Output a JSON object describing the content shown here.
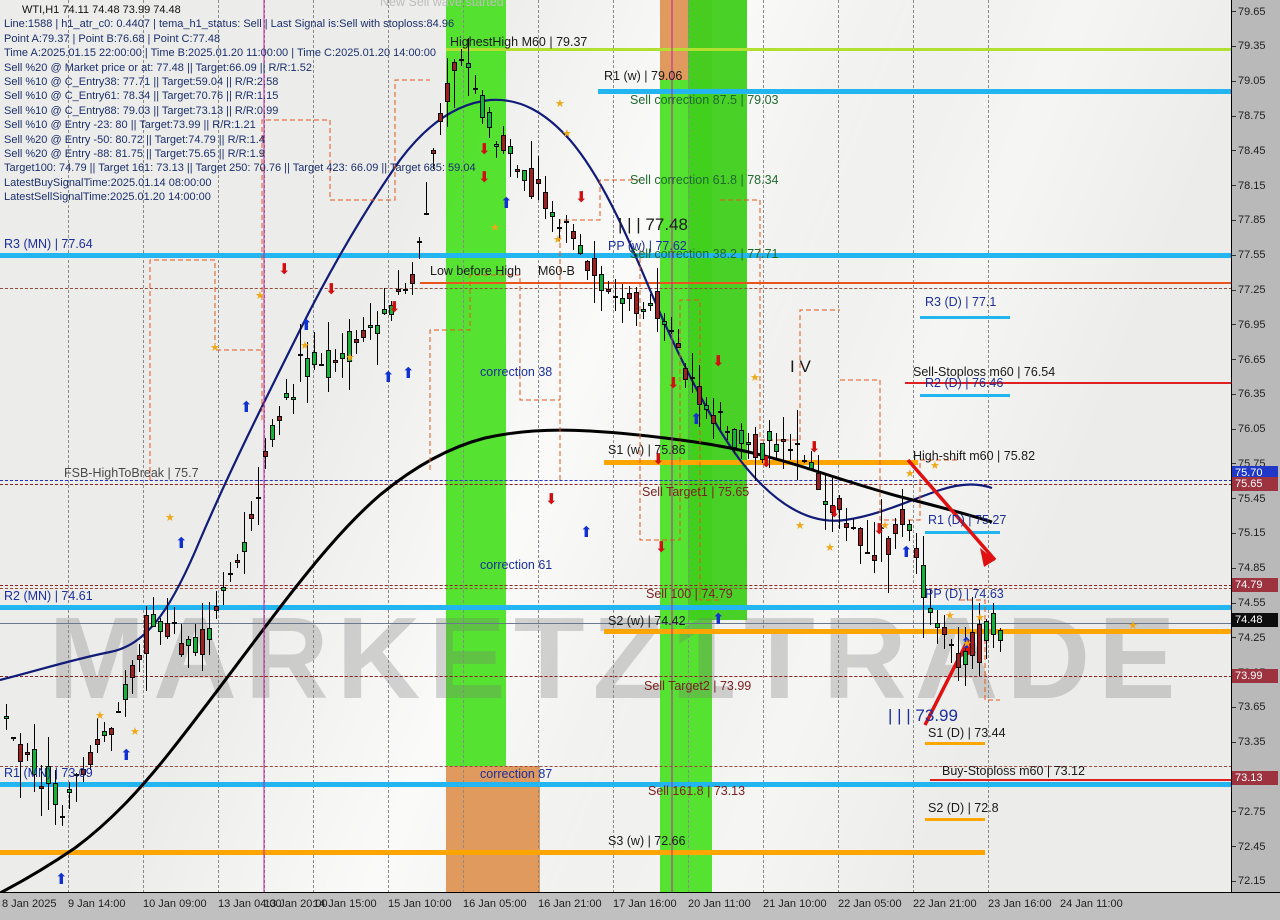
{
  "window": {
    "title": "WTI,H1"
  },
  "header": {
    "symbol_line": "WTI,H1  74.11 74.48 73.99 74.48",
    "lines": [
      "Line:1588 | h1_atr_c0: 0.4407 | tema_h1_status: Sell | Last Signal is:Sell with stoploss:84.96",
      "Point A:79.37 |  Point B:76.68 |  Point C:77.48",
      "Time A:2025.01.15 22:00:00 | Time B:2025.01.20 11:00:00 | Time C:2025.01.20 14:00:00",
      "Sell %20 @ Market price or at: 77.48 || Target:66.09 || R/R:1.52",
      "Sell %10 @ C_Entry38: 77.71 || Target:59.04 || R/R:2.58",
      "Sell %10 @ C_Entry61: 78.34 || Target:70.76 || R/R:1.15",
      "Sell %10 @ C_Entry88: 79.03 || Target:73.13 || R/R:0.99",
      "Sell %10 @ Entry -23: 80 || Target:73.99 || R/R:1.21",
      "Sell %20 @ Entry -50: 80.72 || Target:74.79 || R/R:1.4",
      "Sell %20 @ Entry -88: 81.75 || Target:75.65 || R/R:1.9",
      "Target100: 74.79 || Target 161: 73.13 || Target 250: 70.76 || Target 423: 66.09 || Target 685: 59.04",
      "LatestBuySignalTime:2025.01.14 08:00:00",
      "LatestSellSignalTime:2025.01.20 14:00:00"
    ],
    "wave_banner": "New Sell wave started"
  },
  "watermark": "MARKETZ1TRADE",
  "chart_data": {
    "type": "line",
    "title": "WTI,H1  74.11 74.48 73.99 74.48",
    "xlabel": "",
    "ylabel": "",
    "ylim": [
      72.05,
      79.75
    ],
    "grid": true,
    "legend": "none",
    "price_ticks": [
      79.65,
      79.35,
      79.05,
      78.75,
      78.45,
      78.15,
      77.85,
      77.55,
      77.25,
      76.95,
      76.65,
      76.35,
      76.05,
      75.75,
      75.45,
      75.15,
      74.85,
      74.55,
      74.25,
      73.95,
      73.65,
      73.35,
      73.05,
      72.75,
      72.45,
      72.15
    ],
    "time_ticks": [
      "8 Jan 2025",
      "9 Jan 14:00",
      "10 Jan 09:00",
      "13 Jan 04:00",
      "13 Jan 20:00",
      "14 Jan 15:00",
      "15 Jan 10:00",
      "16 Jan 05:00",
      "16 Jan 21:00",
      "17 Jan 16:00",
      "20 Jan 11:00",
      "21 Jan 10:00",
      "22 Jan 05:00",
      "22 Jan 21:00",
      "23 Jan 16:00",
      "24 Jan 11:00"
    ],
    "price_badges": [
      {
        "value": "75.70",
        "style": "blue"
      },
      {
        "value": "75.65",
        "style": "red"
      },
      {
        "value": "74.79",
        "style": "red"
      },
      {
        "value": "74.48",
        "style": "black"
      },
      {
        "value": "73.99",
        "style": "red"
      },
      {
        "value": "73.13",
        "style": "red"
      }
    ],
    "levels": [
      {
        "label": "HighestHigh  M60 | 79.37",
        "value": 79.37,
        "color": "#b3e030",
        "kind": "lime"
      },
      {
        "label": "R1 (w) | 79.06",
        "value": 79.06,
        "color": "#22b5f0",
        "kind": "cyan"
      },
      {
        "label": "Sell correction 87.5 | 79.03",
        "value": 79.03,
        "color": "#1f6b2e",
        "kind": "text"
      },
      {
        "label": "Sell correction 61.8 | 78.34",
        "value": 78.34,
        "color": "#1f6b2e",
        "kind": "text"
      },
      {
        "label": "| | | 77.48",
        "value": 77.48,
        "color": "#1a1a1a",
        "kind": "text"
      },
      {
        "label": "PP (w) | 77.62",
        "value": 77.62,
        "color": "#1b2f9e",
        "kind": "cyan"
      },
      {
        "label": "Sell correction 38.2 | 77.71",
        "value": 77.71,
        "color": "#1f6b2e",
        "kind": "text"
      },
      {
        "label": "R3 (MN) | 77.64",
        "value": 77.64,
        "color": "#22b5f0",
        "kind": "cyan"
      },
      {
        "label": "Low before High",
        "value": 77.2,
        "color": "#1a1a1a",
        "kind": "text"
      },
      {
        "label": "M60-B",
        "value": 77.2,
        "color": "#1a1a1a",
        "kind": "text"
      },
      {
        "label": "R3 (D) | 77.1",
        "value": 77.1,
        "color": "#22b5f0",
        "kind": "cyan-t"
      },
      {
        "label": "Sell-Stoploss m60 | 76.54",
        "value": 76.54,
        "color": "#e02020",
        "kind": "red"
      },
      {
        "label": "R2 (D) | 76.46",
        "value": 76.46,
        "color": "#22b5f0",
        "kind": "cyan-t"
      },
      {
        "label": "S1 (w) | 75.86",
        "value": 75.86,
        "color": "#ffa500",
        "kind": "orange"
      },
      {
        "label": "High-shift m60 | 75.82",
        "value": 75.82,
        "color": "#1f6b2e",
        "kind": "text"
      },
      {
        "label": "FSB-HighToBreak | 75.7",
        "value": 75.7,
        "color": "#2030c0",
        "kind": "bluedash"
      },
      {
        "label": "Sell Target1 | 75.65",
        "value": 75.65,
        "color": "#8e2020",
        "kind": "reddash"
      },
      {
        "label": "R1 (D) | 75.27",
        "value": 75.27,
        "color": "#22b5f0",
        "kind": "cyan-t"
      },
      {
        "label": "Sell 100 | 74.79",
        "value": 74.79,
        "color": "#8e2020",
        "kind": "reddash"
      },
      {
        "label": "PP (D) | 74.63",
        "value": 74.63,
        "color": "#22b5f0",
        "kind": "cyan"
      },
      {
        "label": "R2 (MN) | 74.61",
        "value": 74.61,
        "color": "#22b5f0",
        "kind": "cyan"
      },
      {
        "label": "S2 (w) | 74.42",
        "value": 74.42,
        "color": "#ffa500",
        "kind": "orange"
      },
      {
        "label": "Sell Target2 | 73.99",
        "value": 73.99,
        "color": "#8e2020",
        "kind": "reddash"
      },
      {
        "label": "| | | 73.99",
        "value": 73.99,
        "color": "#2030c0",
        "kind": "text"
      },
      {
        "label": "S1 (D) | 73.44",
        "value": 73.44,
        "color": "#ffa500",
        "kind": "orange-t"
      },
      {
        "label": "Buy-Stoploss m60 | 73.12",
        "value": 73.12,
        "color": "#e02020",
        "kind": "red"
      },
      {
        "label": "Sell 161.8 | 73.13",
        "value": 73.13,
        "color": "#8e2020",
        "kind": "text"
      },
      {
        "label": "R1 (MN) | 73.09",
        "value": 73.09,
        "color": "#22b5f0",
        "kind": "cyan"
      },
      {
        "label": "S2 (D) | 72.8",
        "value": 72.8,
        "color": "#ffa500",
        "kind": "orange-t"
      },
      {
        "label": "S3 (w) | 72.66",
        "value": 72.66,
        "color": "#ffa500",
        "kind": "orange"
      }
    ],
    "zone_labels": [
      {
        "label": "correction 38",
        "value": 76.6
      },
      {
        "label": "correction 61",
        "value": 75.1
      },
      {
        "label": "correction 87",
        "value": 73.2
      },
      {
        "label": "I V",
        "value": 76.6
      }
    ]
  },
  "levels_text": {
    "highest_high": "HighestHigh  M60 | 79.37",
    "r1_w": "R1 (w) | 79.06",
    "sell_corr_875": "Sell correction 87.5 | 79.03",
    "sell_corr_618": "Sell correction 61.8 | 78.34",
    "mid_7748": "| | | 77.48",
    "pp_w": "PP (w) | 77.62",
    "sell_corr_382": "Sell correction 38.2 | 77.71",
    "r3_mn": "R3 (MN) | 77.64",
    "low_before_high": "Low before High",
    "m60_b": "M60-B",
    "r3_d": "R3 (D) | 77.1",
    "sell_stoploss": "Sell-Stoploss m60 | 76.54",
    "r2_d": "R2 (D) | 76.46",
    "s1_w": "S1 (w) | 75.86",
    "high_shift": "High-shift m60 | 75.82",
    "fsb": "FSB-HighToBreak | 75.7",
    "sell_target1": "Sell Target1 | 75.65",
    "r1_d": "R1 (D) | 75.27",
    "sell_100": "Sell 100 | 74.79",
    "pp_d": "PP (D) | 74.63",
    "r2_mn": "R2 (MN) | 74.61",
    "s2_w": "S2 (w) | 74.42",
    "sell_target2": "Sell Target2 | 73.99",
    "mid_7399": "| | | 73.99",
    "s1_d": "S1 (D) | 73.44",
    "buy_stoploss": "Buy-Stoploss m60 | 73.12",
    "sell_1618": "Sell 161.8 | 73.13",
    "r1_mn": "R1 (MN) | 73.09",
    "s2_d": "S2 (D) | 72.8",
    "s3_w": "S3 (w) | 72.66",
    "correction_38": "correction 38",
    "correction_61": "correction 61",
    "correction_87": "correction 87",
    "wave_iv": "I V"
  }
}
